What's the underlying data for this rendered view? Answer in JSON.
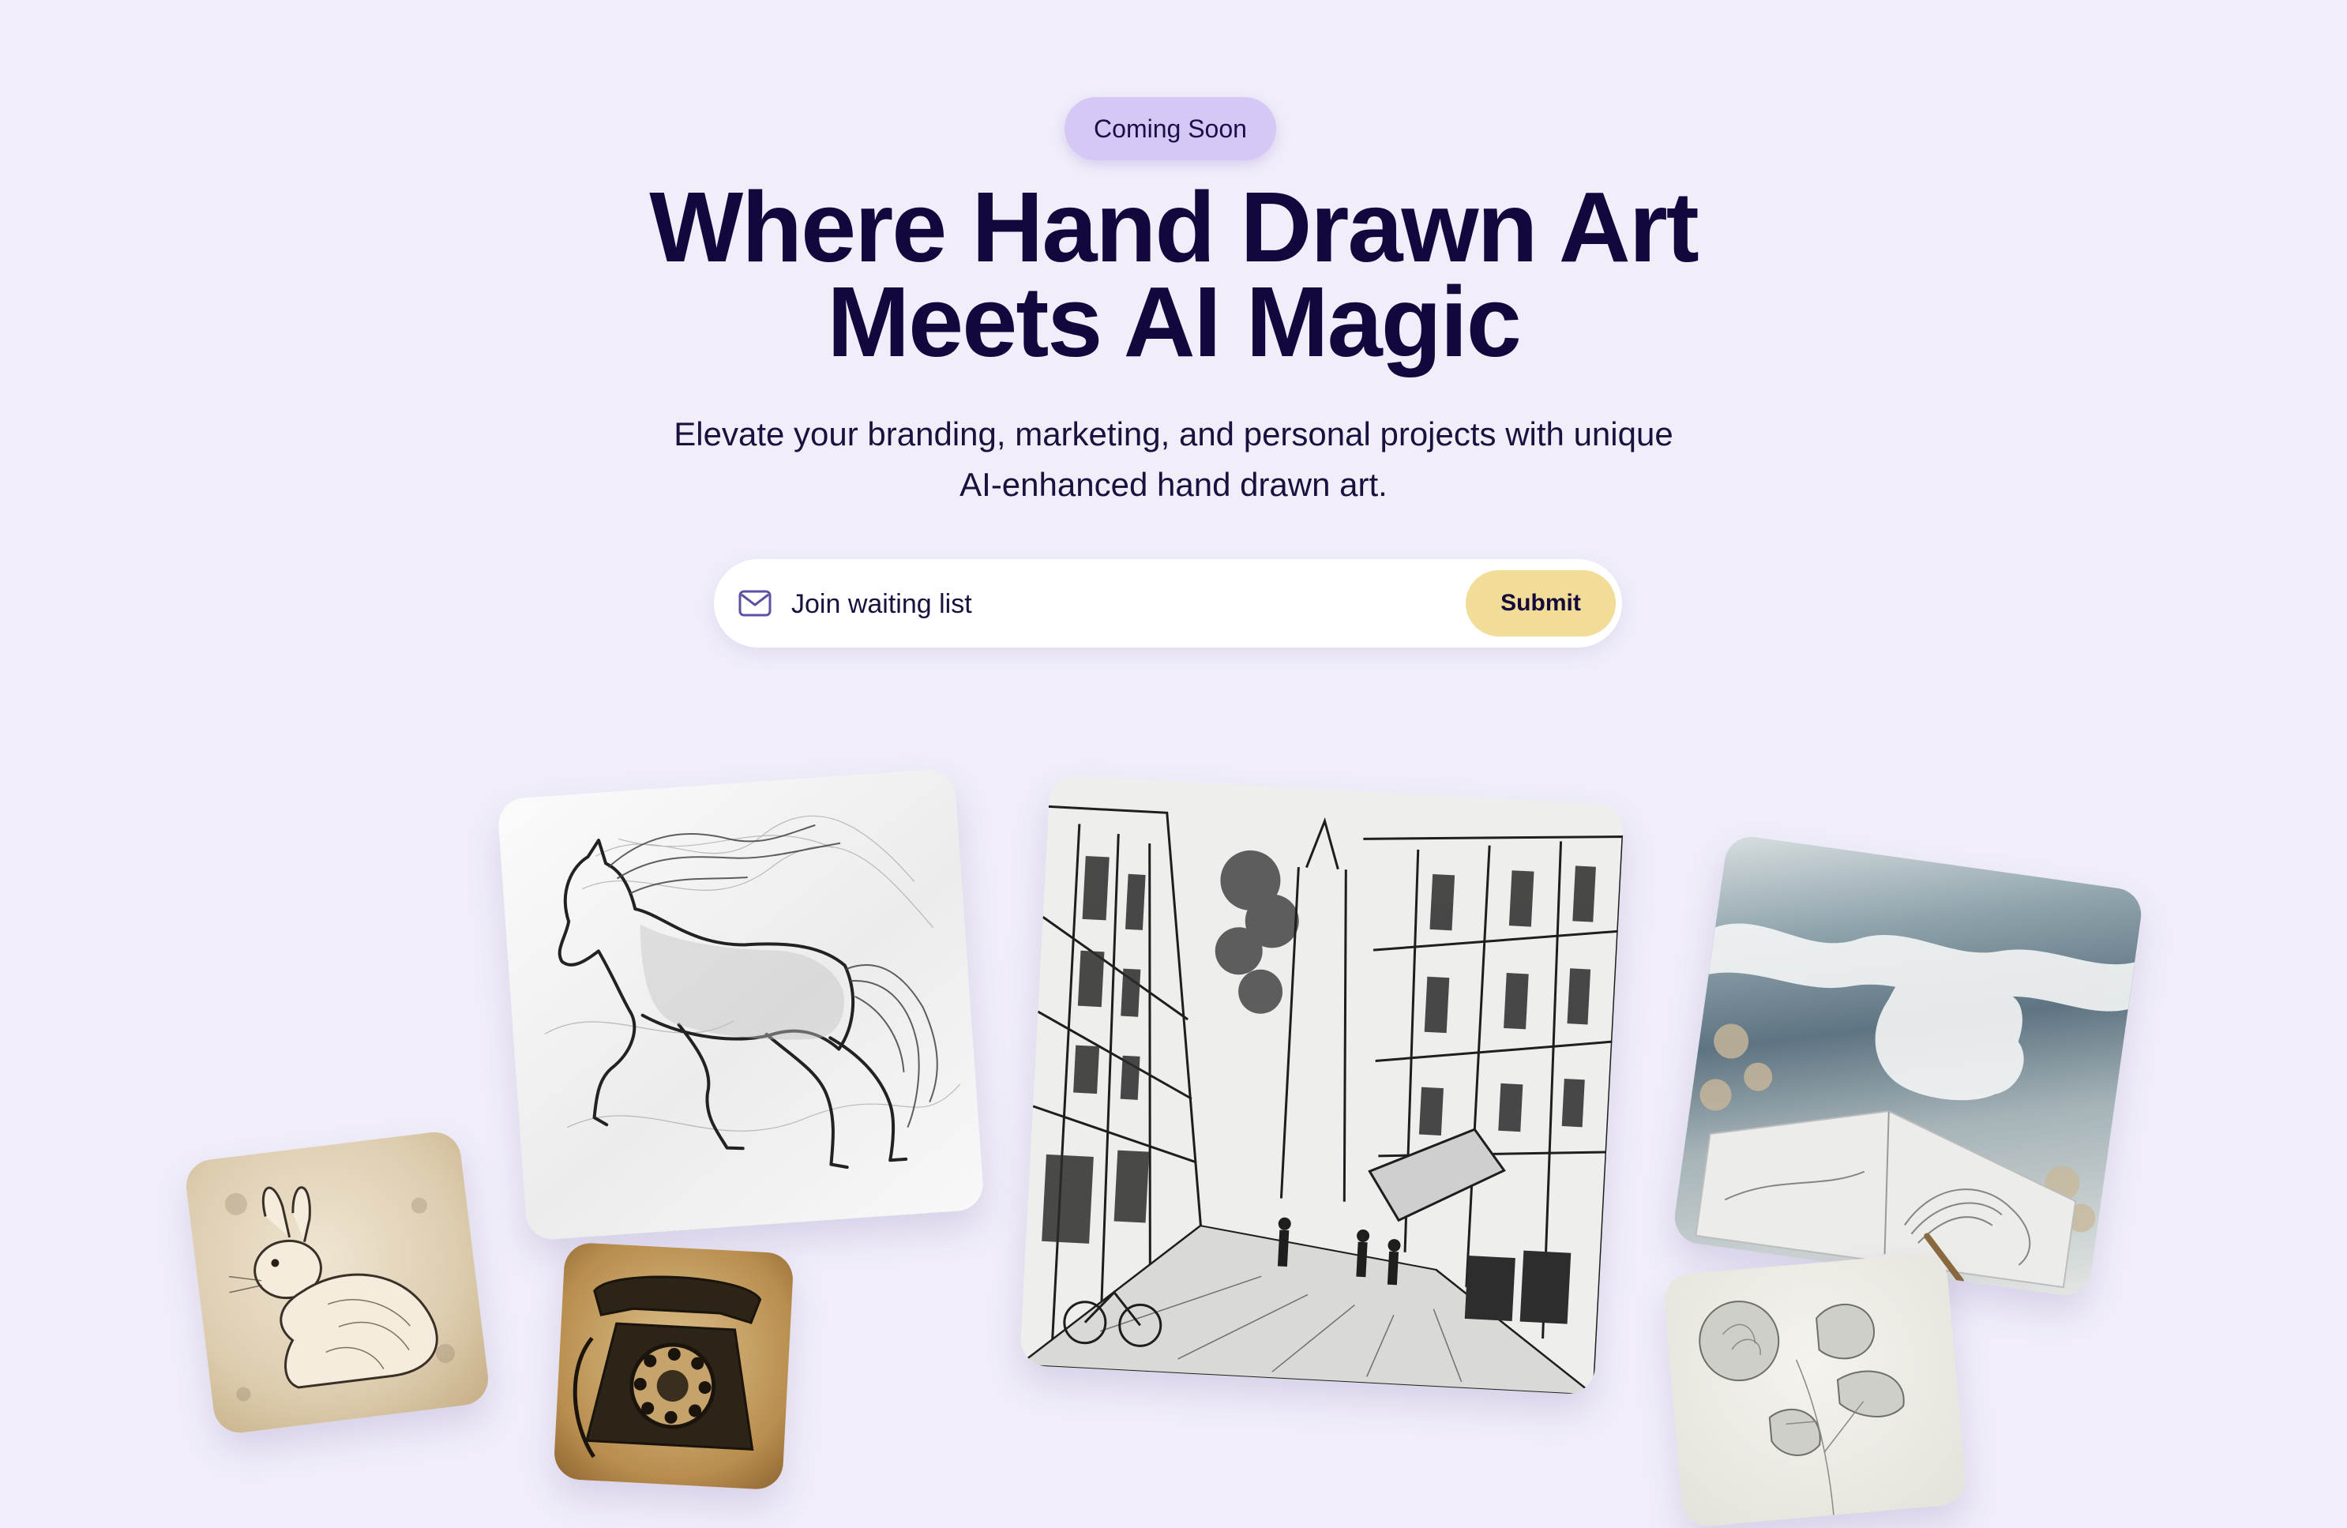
{
  "badge": {
    "label": "Coming Soon"
  },
  "hero": {
    "title_line1": "Where Hand Drawn Art",
    "title_line2": "Meets AI Magic",
    "subtitle_line1": "Elevate your branding, marketing, and personal projects with unique",
    "subtitle_line2": "AI-enhanced hand drawn art."
  },
  "signup": {
    "placeholder": "Join waiting list",
    "submit_label": "Submit",
    "icon": "mail-icon"
  },
  "gallery": {
    "items": [
      {
        "subject": "horse-sketch"
      },
      {
        "subject": "street-sketch"
      },
      {
        "subject": "ocean-wave-photo"
      },
      {
        "subject": "rabbit-sketch"
      },
      {
        "subject": "telephone-sketch"
      },
      {
        "subject": "rose-sketch"
      }
    ]
  },
  "colors": {
    "background": "#f1eefa",
    "badge": "#d5c8f5",
    "submit": "#f1dc98",
    "heading": "#14073d"
  }
}
